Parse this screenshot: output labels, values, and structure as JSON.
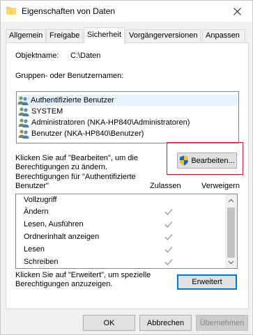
{
  "window": {
    "title": "Eigenschaften von Daten"
  },
  "tabs": [
    {
      "label": "Allgemein",
      "active": false
    },
    {
      "label": "Freigabe",
      "active": false
    },
    {
      "label": "Sicherheit",
      "active": true
    },
    {
      "label": "Vorgängerversionen",
      "active": false
    },
    {
      "label": "Anpassen",
      "active": false
    }
  ],
  "security": {
    "object_name_label": "Objektname:",
    "object_name_value": "C:\\Daten",
    "groups_label": "Gruppen- oder Benutzernamen:",
    "users": [
      "Authentifizierte Benutzer",
      "SYSTEM",
      "Administratoren (NKA-HP840\\Administratoren)",
      "Benutzer (NKA-HP840\\Benutzer)"
    ],
    "edit_hint_line1": "Klicken Sie auf \"Bearbeiten\", um die",
    "edit_hint_line2": "Berechtigungen zu ändern.",
    "edit_button": "Bearbeiten...",
    "permissions_for_line1": "Berechtigungen für \"Authentifizierte",
    "permissions_for_line2": "Benutzer\"",
    "allow_header": "Zulassen",
    "deny_header": "Verweigern",
    "permissions": [
      {
        "name": "Vollzugriff",
        "allow": false
      },
      {
        "name": "Ändern",
        "allow": true
      },
      {
        "name": "Lesen, Ausführen",
        "allow": true
      },
      {
        "name": "Ordnerinhalt anzeigen",
        "allow": true
      },
      {
        "name": "Lesen",
        "allow": true
      },
      {
        "name": "Schreiben",
        "allow": true
      }
    ],
    "advanced_hint_line1": "Klicken Sie auf \"Erweitert\", um spezielle",
    "advanced_hint_line2": "Berechtigungen anzuzeigen.",
    "advanced_button": "Erweitert"
  },
  "footer": {
    "ok": "OK",
    "cancel": "Abbrechen",
    "apply": "Übernehmen"
  },
  "colors": {
    "highlight": "#cc1c2e",
    "check": "#a8a8a8",
    "selection": "#e5f3ff"
  }
}
